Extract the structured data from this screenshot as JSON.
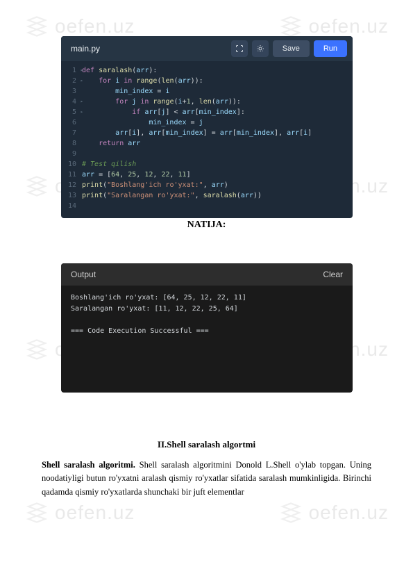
{
  "watermark_text": "oefen.uz",
  "editor": {
    "filename": "main.py",
    "save_label": "Save",
    "run_label": "Run",
    "code_lines": [
      {
        "n": "1",
        "fold": true,
        "html": "<span class='kw'>def</span> <span class='fn'>saralash</span>(<span class='var'>arr</span>):"
      },
      {
        "n": "2",
        "fold": true,
        "html": "    <span class='kw'>for</span> <span class='var'>i</span> <span class='kw'>in</span> <span class='fn'>range</span>(<span class='fn'>len</span>(<span class='var'>arr</span>)):"
      },
      {
        "n": "3",
        "fold": false,
        "html": "        <span class='var'>min_index</span> = <span class='var'>i</span>"
      },
      {
        "n": "4",
        "fold": true,
        "html": "        <span class='kw'>for</span> <span class='var'>j</span> <span class='kw'>in</span> <span class='fn'>range</span>(<span class='var'>i</span>+<span class='num'>1</span>, <span class='fn'>len</span>(<span class='var'>arr</span>)):"
      },
      {
        "n": "5",
        "fold": true,
        "html": "            <span class='kw'>if</span> <span class='var'>arr</span>[<span class='var'>j</span>] &lt; <span class='var'>arr</span>[<span class='var'>min_index</span>]:"
      },
      {
        "n": "6",
        "fold": false,
        "html": "                <span class='var'>min_index</span> = <span class='var'>j</span>"
      },
      {
        "n": "7",
        "fold": false,
        "html": "        <span class='var'>arr</span>[<span class='var'>i</span>], <span class='var'>arr</span>[<span class='var'>min_index</span>] = <span class='var'>arr</span>[<span class='var'>min_index</span>], <span class='var'>arr</span>[<span class='var'>i</span>]"
      },
      {
        "n": "8",
        "fold": false,
        "html": "    <span class='kw'>return</span> <span class='var'>arr</span>"
      },
      {
        "n": "9",
        "fold": false,
        "html": ""
      },
      {
        "n": "10",
        "fold": false,
        "html": "<span class='com'># Test qilish</span>"
      },
      {
        "n": "11",
        "fold": false,
        "html": "<span class='var'>arr</span> = [<span class='num'>64</span>, <span class='num'>25</span>, <span class='num'>12</span>, <span class='num'>22</span>, <span class='num'>11</span>]"
      },
      {
        "n": "12",
        "fold": false,
        "html": "<span class='fn'>print</span>(<span class='str'>\"Boshlang'ich ro'yxat:\"</span>, <span class='var'>arr</span>)"
      },
      {
        "n": "13",
        "fold": false,
        "html": "<span class='fn'>print</span>(<span class='str'>\"Saralangan ro'yxat:\"</span>, <span class='fn'>saralash</span>(<span class='var'>arr</span>))"
      },
      {
        "n": "14",
        "fold": false,
        "html": ""
      }
    ]
  },
  "natija_label": "NATIJA:",
  "output": {
    "title": "Output",
    "clear_label": "Clear",
    "text": "Boshlang'ich ro'yxat: [64, 25, 12, 22, 11]\nSaralangan ro'yxat: [11, 12, 22, 25, 64]\n\n=== Code Execution Successful ==="
  },
  "section_title": "II.Shell saralash algortmi",
  "body_html": "<b>Shell saralash algoritmi.</b> Shell saralash algoritmini Donold L.Shell o'ylab topgan. Uning noodatiyligi butun ro'yxatni aralash qismiy ro'yxatlar sifatida saralash mumkinligida. Birinchi qadamda qismiy ro'yxatlarda shunchaki bir juft elementlar"
}
